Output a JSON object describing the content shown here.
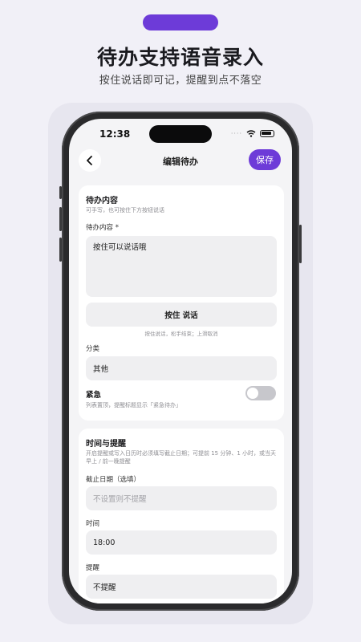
{
  "promo": {
    "headline": "待办支持语音录入",
    "subline": "按住说话即可记，提醒到点不落空"
  },
  "status_bar": {
    "time": "12:38"
  },
  "nav": {
    "title": "编辑待办",
    "save_label": "保存"
  },
  "content_card": {
    "title": "待办内容",
    "subtitle": "可手写，也可按住下方按钮说话",
    "field_label": "待办内容 *",
    "field_value": "按住可以说话哦",
    "hold_button_label": "按住 说话",
    "hold_hint": "按住说话，松手结束；上滑取消",
    "category_label": "分类",
    "category_value": "其他",
    "urgent_label": "紧急",
    "urgent_hint": "列表置顶，提醒标题显示「紧急待办」",
    "urgent_on": false
  },
  "reminder_card": {
    "title": "时间与提醒",
    "subtitle": "开启提醒或写入日历时必须填写截止日期；可提前 15 分钟、1 小时，或当天早上 / 前一晚提醒",
    "due_label": "截止日期（选填）",
    "due_placeholder": "不设置则不提醒",
    "time_label": "时间",
    "time_value": "18:00",
    "remind_label": "提醒",
    "remind_value": "不提醒"
  },
  "colors": {
    "accent": "#6d3bd8",
    "background": "#f1f0f7",
    "card": "#ffffff",
    "field": "#efeff1"
  }
}
